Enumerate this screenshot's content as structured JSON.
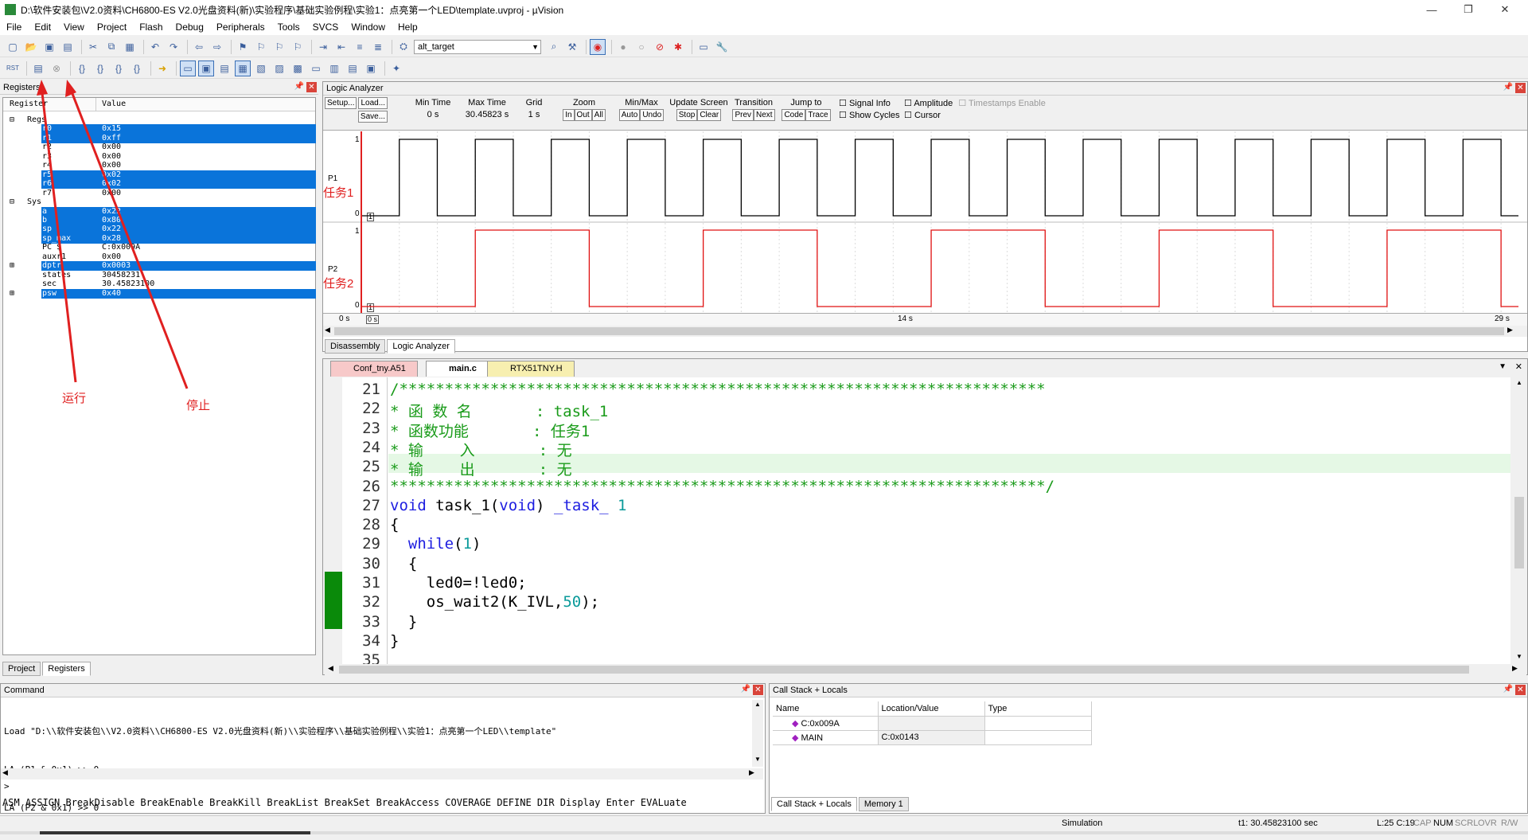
{
  "window": {
    "title": "D:\\软件安装包\\V2.0资料\\CH6800-ES V2.0光盘资料(新)\\实验程序\\基础实验例程\\实验1：点亮第一个LED\\template.uvproj - µVision",
    "controls": [
      "—",
      "❐",
      "✕"
    ]
  },
  "menu": [
    "File",
    "Edit",
    "View",
    "Project",
    "Flash",
    "Debug",
    "Peripherals",
    "Tools",
    "SVCS",
    "Window",
    "Help"
  ],
  "toolbar": {
    "target": "alt_target",
    "rst_label": "RST"
  },
  "registers": {
    "panel_title": "Registers",
    "col_register": "Register",
    "col_value": "Value",
    "rows": [
      {
        "name": "Regs",
        "value": "",
        "indent": 0,
        "sel": false,
        "exp": "-"
      },
      {
        "name": "r0",
        "value": "0x15",
        "indent": 2,
        "sel": true,
        "exp": ""
      },
      {
        "name": "r1",
        "value": "0xff",
        "indent": 2,
        "sel": true,
        "exp": ""
      },
      {
        "name": "r2",
        "value": "0x00",
        "indent": 2,
        "sel": false,
        "exp": ""
      },
      {
        "name": "r3",
        "value": "0x00",
        "indent": 2,
        "sel": false,
        "exp": ""
      },
      {
        "name": "r4",
        "value": "0x00",
        "indent": 2,
        "sel": false,
        "exp": ""
      },
      {
        "name": "r5",
        "value": "0x02",
        "indent": 2,
        "sel": true,
        "exp": ""
      },
      {
        "name": "r6",
        "value": "0x02",
        "indent": 2,
        "sel": true,
        "exp": ""
      },
      {
        "name": "r7",
        "value": "0x00",
        "indent": 2,
        "sel": false,
        "exp": ""
      },
      {
        "name": "Sys",
        "value": "",
        "indent": 0,
        "sel": false,
        "exp": "-"
      },
      {
        "name": "a",
        "value": "0x22",
        "indent": 2,
        "sel": true,
        "exp": ""
      },
      {
        "name": "b",
        "value": "0x80",
        "indent": 2,
        "sel": true,
        "exp": ""
      },
      {
        "name": "sp",
        "value": "0x22",
        "indent": 2,
        "sel": true,
        "exp": ""
      },
      {
        "name": "sp_max",
        "value": "0x28",
        "indent": 2,
        "sel": true,
        "exp": ""
      },
      {
        "name": "PC  $",
        "value": "C:0x009A",
        "indent": 2,
        "sel": false,
        "exp": ""
      },
      {
        "name": "auxr1",
        "value": "0x00",
        "indent": 2,
        "sel": false,
        "exp": ""
      },
      {
        "name": "dptr",
        "value": "0x0003",
        "indent": 2,
        "sel": true,
        "exp": "+"
      },
      {
        "name": "states",
        "value": "30458231",
        "indent": 2,
        "sel": false,
        "exp": ""
      },
      {
        "name": "sec",
        "value": "30.45823100",
        "indent": 2,
        "sel": false,
        "exp": ""
      },
      {
        "name": "psw",
        "value": "0x40",
        "indent": 2,
        "sel": true,
        "exp": "+"
      }
    ],
    "tab_project": "Project",
    "tab_registers": "Registers"
  },
  "annotations": {
    "run": "运行",
    "stop": "停止"
  },
  "logic_analyzer": {
    "title": "Logic Analyzer",
    "setup": "Setup...",
    "load": "Load...",
    "save": "Save...",
    "min_time_label": "Min Time",
    "min_time": "0 s",
    "max_time_label": "Max Time",
    "max_time": "30.45823 s",
    "grid_label": "Grid",
    "grid": "1 s",
    "zoom_label": "Zoom",
    "zoom_in": "In",
    "zoom_out": "Out",
    "zoom_all": "All",
    "minmax_label": "Min/Max",
    "auto": "Auto",
    "undo": "Undo",
    "update_label": "Update Screen",
    "stop": "Stop",
    "clear": "Clear",
    "transition_label": "Transition",
    "prev": "Prev",
    "next": "Next",
    "jump_label": "Jump to",
    "code": "Code",
    "trace": "Trace",
    "signal_info": "Signal Info",
    "show_cycles": "Show Cycles",
    "amplitude": "Amplitude",
    "cursor": "Cursor",
    "timestamps": "Timestamps Enable",
    "sig1": "P1",
    "sig1_task": "任务1",
    "sig2": "P2",
    "sig2_task": "任务2",
    "y_hi": "1",
    "y_lo": "0",
    "marker": "1",
    "t_start": "0 s",
    "t_cursor": "0 s",
    "t_mid": "14 s",
    "t_end": "29 s",
    "tab_disasm": "Disassembly",
    "tab_la": "Logic Analyzer"
  },
  "editor": {
    "tabs": [
      "Conf_tny.A51",
      "main.c",
      "RTX51TNY.H"
    ],
    "lines": [
      {
        "n": "21",
        "parts": [
          {
            "c": "cmt",
            "t": "/***********************************************************************"
          }
        ]
      },
      {
        "n": "22",
        "parts": [
          {
            "c": "cmt",
            "t": "* 函 数 名       : task_1"
          }
        ]
      },
      {
        "n": "23",
        "parts": [
          {
            "c": "cmt",
            "t": "* 函数功能       : 任务1"
          }
        ]
      },
      {
        "n": "24",
        "parts": [
          {
            "c": "cmt",
            "t": "* 输    入       : 无"
          }
        ]
      },
      {
        "n": "25",
        "parts": [
          {
            "c": "cmt",
            "t": "* 输    出       : 无"
          }
        ]
      },
      {
        "n": "26",
        "parts": [
          {
            "c": "cmt",
            "t": "************************************************************************/"
          }
        ]
      },
      {
        "n": "27",
        "parts": [
          {
            "c": "kw",
            "t": "void "
          },
          {
            "c": "txt",
            "t": "task_1("
          },
          {
            "c": "kw",
            "t": "void"
          },
          {
            "c": "txt",
            "t": ") "
          },
          {
            "c": "kw",
            "t": "_task_ "
          },
          {
            "c": "num",
            "t": "1"
          }
        ]
      },
      {
        "n": "28",
        "parts": [
          {
            "c": "txt",
            "t": "{"
          }
        ]
      },
      {
        "n": "29",
        "parts": [
          {
            "c": "txt",
            "t": "  "
          },
          {
            "c": "kw",
            "t": "while"
          },
          {
            "c": "txt",
            "t": "("
          },
          {
            "c": "num",
            "t": "1"
          },
          {
            "c": "txt",
            "t": ")"
          }
        ]
      },
      {
        "n": "30",
        "parts": [
          {
            "c": "txt",
            "t": "  {"
          }
        ]
      },
      {
        "n": "31",
        "parts": [
          {
            "c": "txt",
            "t": "    led0=!led0;"
          }
        ]
      },
      {
        "n": "32",
        "parts": [
          {
            "c": "txt",
            "t": "    os_wait2(K_IVL,"
          },
          {
            "c": "num",
            "t": "50"
          },
          {
            "c": "txt",
            "t": ");"
          }
        ]
      },
      {
        "n": "33",
        "parts": [
          {
            "c": "txt",
            "t": "  }"
          }
        ]
      },
      {
        "n": "34",
        "parts": [
          {
            "c": "txt",
            "t": "}"
          }
        ]
      },
      {
        "n": "35",
        "parts": [
          {
            "c": "txt",
            "t": ""
          }
        ]
      }
    ]
  },
  "command": {
    "title": "Command",
    "lines": [
      "Load \"D:\\\\软件安装包\\\\V2.0资料\\\\CH6800-ES V2.0光盘资料(新)\\\\实验程序\\\\基础实验例程\\\\实验1：点亮第一个LED\\\\template\"",
      "LA (P1 & 0x1) >> 0",
      "LA (P2 & 0x1) >> 0"
    ],
    "prompt": ">",
    "keywords": "ASM ASSIGN BreakDisable BreakEnable BreakKill BreakList BreakSet BreakAccess COVERAGE DEFINE DIR Display Enter EVALuate"
  },
  "callstack": {
    "title": "Call Stack + Locals",
    "col_name": "Name",
    "col_loc": "Location/Value",
    "col_type": "Type",
    "rows": [
      {
        "name": "C:0x009A",
        "loc": "",
        "type": ""
      },
      {
        "name": "MAIN",
        "loc": "C:0x0143",
        "type": ""
      }
    ],
    "tab_cs": "Call Stack + Locals",
    "tab_mem": "Memory 1"
  },
  "status": {
    "mode": "Simulation",
    "time": "t1: 30.45823100 sec",
    "pos": "L:25 C:19",
    "cap": "CAP",
    "numlk": "NUM",
    "scrl": "SCRL",
    "ovr": "OVR",
    "rw": "R/W"
  },
  "colors": {
    "selection": "#0a74da",
    "p1": "#000000",
    "p2": "#e01010",
    "annotation": "#e02020"
  },
  "chart_data": {
    "type": "line",
    "x_range": [
      0,
      30.45823
    ],
    "series": [
      {
        "name": "P1",
        "period": 2.0,
        "start_level": 0,
        "color": "#000000"
      },
      {
        "name": "P2",
        "period": 6.0,
        "start_level": 0,
        "color": "#e01010"
      }
    ]
  }
}
